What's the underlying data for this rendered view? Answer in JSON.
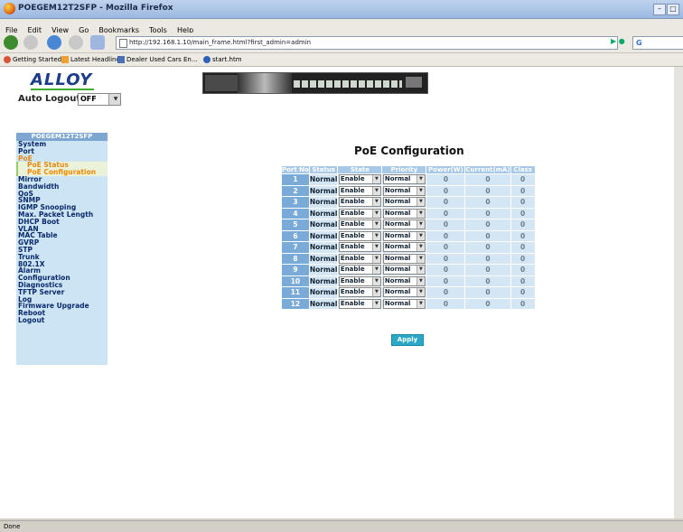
{
  "window": {
    "title": "POEGEM12T2SFP - Mozilla Firefox"
  },
  "menubar": [
    "File",
    "Edit",
    "View",
    "Go",
    "Bookmarks",
    "Tools",
    "Help"
  ],
  "url": "http://192.168.1.10/main_frame.html?first_admin=admin",
  "search_placeholder": "G",
  "bookmarks": [
    "Getting Started",
    "Latest Headlines",
    "Dealer Used Cars En...",
    "start.htm"
  ],
  "brand": {
    "logo": "ALLOY"
  },
  "auto_logout": {
    "label": "Auto Logout",
    "value": "OFF"
  },
  "sidebar": {
    "title": "POEGEM12T2SFP",
    "items": [
      {
        "label": "System"
      },
      {
        "label": "Port"
      },
      {
        "label": "PoE"
      },
      {
        "label": "PoE Status"
      },
      {
        "label": "PoE Configuration"
      },
      {
        "label": "Mirror"
      },
      {
        "label": "Bandwidth"
      },
      {
        "label": "QoS"
      },
      {
        "label": "SNMP"
      },
      {
        "label": "IGMP Snooping"
      },
      {
        "label": "Max. Packet Length"
      },
      {
        "label": "DHCP Boot"
      },
      {
        "label": "VLAN"
      },
      {
        "label": "MAC Table"
      },
      {
        "label": "GVRP"
      },
      {
        "label": "STP"
      },
      {
        "label": "Trunk"
      },
      {
        "label": "802.1X"
      },
      {
        "label": "Alarm"
      },
      {
        "label": "Configuration"
      },
      {
        "label": "Diagnostics"
      },
      {
        "label": "TFTP Server"
      },
      {
        "label": "Log"
      },
      {
        "label": "Firmware Upgrade"
      },
      {
        "label": "Reboot"
      },
      {
        "label": "Logout"
      }
    ]
  },
  "page": {
    "title": "PoE Configuration"
  },
  "table": {
    "headers": [
      "Port No",
      "Status",
      "State",
      "Priority",
      "Power(W)",
      "Current(mA)",
      "Class"
    ],
    "rows": [
      {
        "port": "1",
        "status": "Normal",
        "state": "Enable",
        "priority": "Normal",
        "power": "0",
        "current": "0",
        "class": "0"
      },
      {
        "port": "2",
        "status": "Normal",
        "state": "Enable",
        "priority": "Normal",
        "power": "0",
        "current": "0",
        "class": "0"
      },
      {
        "port": "3",
        "status": "Normal",
        "state": "Enable",
        "priority": "Normal",
        "power": "0",
        "current": "0",
        "class": "0"
      },
      {
        "port": "4",
        "status": "Normal",
        "state": "Enable",
        "priority": "Normal",
        "power": "0",
        "current": "0",
        "class": "0"
      },
      {
        "port": "5",
        "status": "Normal",
        "state": "Enable",
        "priority": "Normal",
        "power": "0",
        "current": "0",
        "class": "0"
      },
      {
        "port": "6",
        "status": "Normal",
        "state": "Enable",
        "priority": "Normal",
        "power": "0",
        "current": "0",
        "class": "0"
      },
      {
        "port": "7",
        "status": "Normal",
        "state": "Enable",
        "priority": "Normal",
        "power": "0",
        "current": "0",
        "class": "0"
      },
      {
        "port": "8",
        "status": "Normal",
        "state": "Enable",
        "priority": "Normal",
        "power": "0",
        "current": "0",
        "class": "0"
      },
      {
        "port": "9",
        "status": "Normal",
        "state": "Enable",
        "priority": "Normal",
        "power": "0",
        "current": "0",
        "class": "0"
      },
      {
        "port": "10",
        "status": "Normal",
        "state": "Enable",
        "priority": "Normal",
        "power": "0",
        "current": "0",
        "class": "0"
      },
      {
        "port": "11",
        "status": "Normal",
        "state": "Enable",
        "priority": "Normal",
        "power": "0",
        "current": "0",
        "class": "0"
      },
      {
        "port": "12",
        "status": "Normal",
        "state": "Enable",
        "priority": "Normal",
        "power": "0",
        "current": "0",
        "class": "0"
      }
    ]
  },
  "apply_label": "Apply",
  "status_text": "Done"
}
